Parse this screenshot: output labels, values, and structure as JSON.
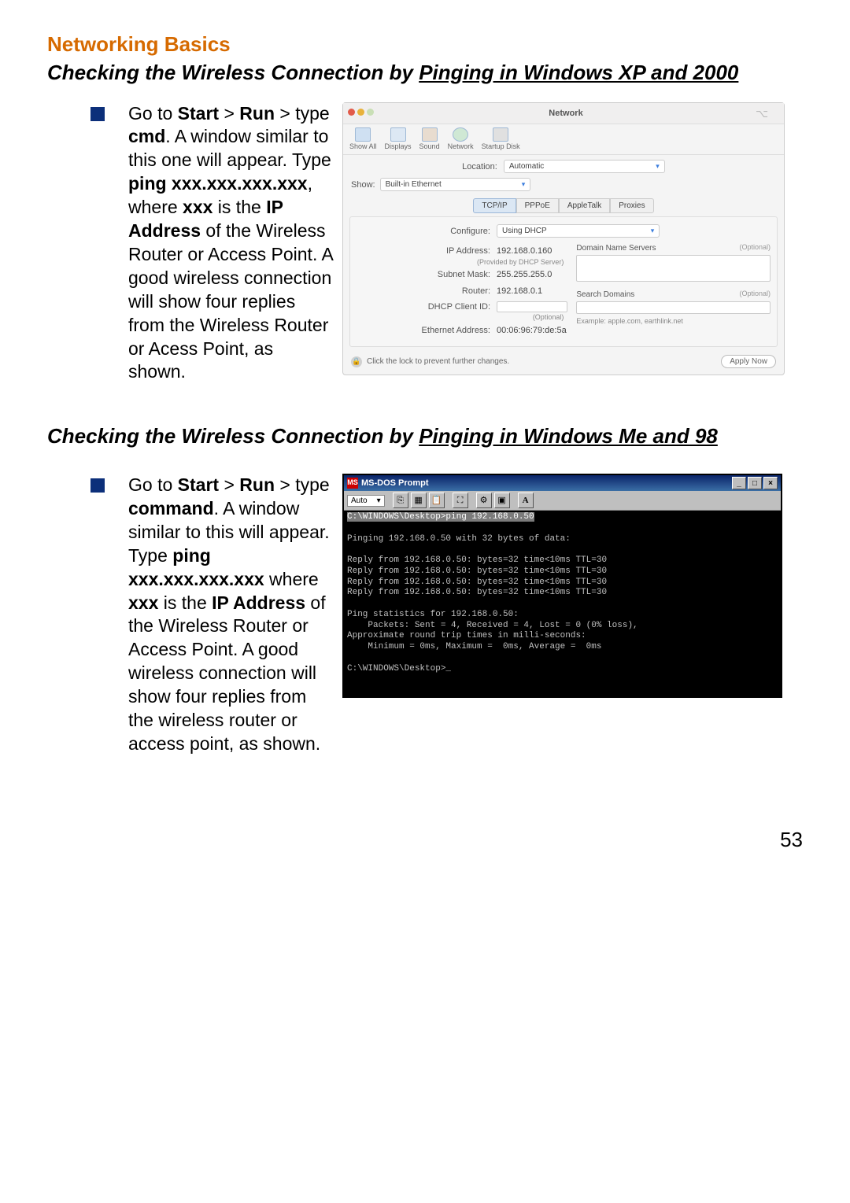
{
  "heading_main": "Networking Basics",
  "section1": {
    "prefix": "Checking the Wireless Connection by ",
    "underlined": "Pinging in Windows XP and 2000"
  },
  "instr1": {
    "t1": "Go to ",
    "b1": "Start",
    "gt1": " > ",
    "b2": "Run",
    "gt2": " > ",
    "t2": "type ",
    "b3": "cmd",
    "t3": ".  A window similar to this one will appear.  Type ",
    "b4": "ping xxx.xxx.xxx.xxx",
    "t4": ", where ",
    "b5": "xxx",
    "t5": " is the ",
    "b6": "IP Address",
    "t6": " of the Wireless Router or Access Point.  A good wireless connection will show four replies from the Wireless Router or Acess Point, as shown."
  },
  "mac": {
    "title": "Network",
    "icons": {
      "showall": "Show All",
      "displays": "Displays",
      "sound": "Sound",
      "network": "Network",
      "startup": "Startup Disk"
    },
    "location_lbl": "Location:",
    "location_val": "Automatic",
    "show_lbl": "Show:",
    "show_val": "Built-in Ethernet",
    "tabs": {
      "tcp": "TCP/IP",
      "pppoe": "PPPoE",
      "atalk": "AppleTalk",
      "proxies": "Proxies"
    },
    "configure_lbl": "Configure:",
    "configure_val": "Using DHCP",
    "ip_lbl": "IP Address:",
    "ip_val": "192.168.0.160",
    "ip_sub": "(Provided by DHCP Server)",
    "mask_lbl": "Subnet Mask:",
    "mask_val": "255.255.255.0",
    "router_lbl": "Router:",
    "router_val": "192.168.0.1",
    "client_lbl": "DHCP Client ID:",
    "client_sub": "(Optional)",
    "eth_lbl": "Ethernet Address:",
    "eth_val": "00:06:96:79:de:5a",
    "dns_lbl": "Domain Name Servers",
    "opt": "(Optional)",
    "search_lbl": "Search Domains",
    "example_lbl": "Example: apple.com, earthlink.net",
    "lock_text": "Click the lock to prevent further changes.",
    "apply": "Apply Now"
  },
  "section2": {
    "prefix": "Checking the Wireless Connection by ",
    "underlined": "Pinging in Windows Me and 98"
  },
  "instr2": {
    "t1": "Go to ",
    "b1": "Start",
    "gt1": " > ",
    "b2": "Run",
    "t2": " > type ",
    "b3": "command",
    "t3": ".  A window similar to this will appear.  Type ",
    "b4": "ping xxx.xxx.xxx.xxx",
    "t4": " where ",
    "b5": "xxx",
    "t5": " is the ",
    "b6": "IP Address",
    "t6": " of the Wireless Router or Access Point.  A good wireless connection will show four replies from the wireless router or access point, as shown."
  },
  "dos": {
    "title": "MS-DOS Prompt",
    "toolbar_sel": "Auto",
    "toolbar_A": "A",
    "line_cmd": "C:\\WINDOWS\\Desktop>ping 192.168.0.50",
    "line_head": "Pinging 192.168.0.50 with 32 bytes of data:",
    "reply1": "Reply from 192.168.0.50: bytes=32 time<10ms TTL=30",
    "reply2": "Reply from 192.168.0.50: bytes=32 time<10ms TTL=30",
    "reply3": "Reply from 192.168.0.50: bytes=32 time<10ms TTL=30",
    "reply4": "Reply from 192.168.0.50: bytes=32 time<10ms TTL=30",
    "stats1": "Ping statistics for 192.168.0.50:",
    "stats2": "    Packets: Sent = 4, Received = 4, Lost = 0 (0% loss),",
    "stats3": "Approximate round trip times in milli-seconds:",
    "stats4": "    Minimum = 0ms, Maximum =  0ms, Average =  0ms",
    "prompt2": "C:\\WINDOWS\\Desktop>_"
  },
  "page_number": "53"
}
